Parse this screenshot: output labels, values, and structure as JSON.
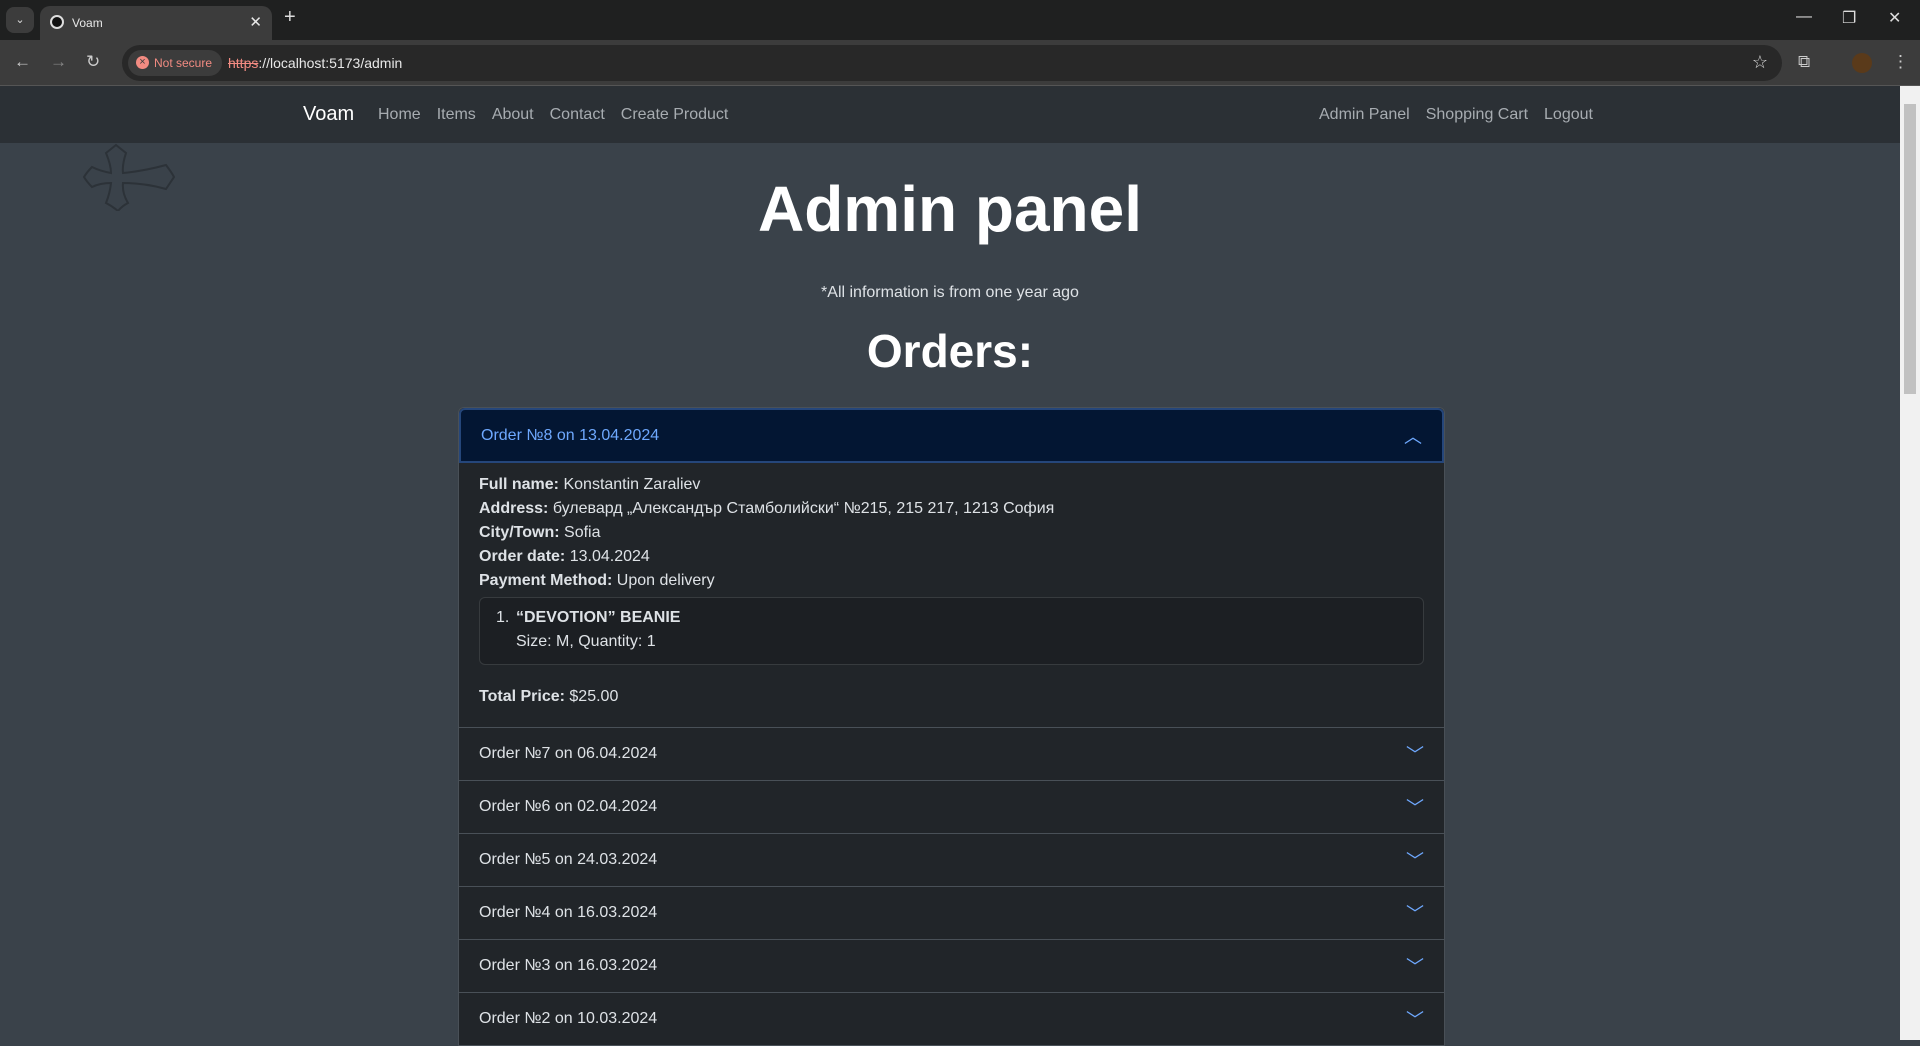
{
  "browser": {
    "tab_title": "Voam",
    "security": "Not secure",
    "url_scheme": "https",
    "url_rest": "://localhost:5173/admin"
  },
  "navbar": {
    "brand": "Voam",
    "left_links": [
      "Home",
      "Items",
      "About",
      "Contact",
      "Create Product"
    ],
    "right_links": [
      "Admin Panel",
      "Shopping Cart",
      "Logout"
    ]
  },
  "page": {
    "title": "Admin panel",
    "subtitle": "*All information is from one year ago",
    "orders_heading": "Orders:"
  },
  "expanded_order": {
    "header": "Order №8 on 13.04.2024",
    "fields": [
      {
        "label": "Full name:",
        "value": "Konstantin Zaraliev"
      },
      {
        "label": "Address:",
        "value": "булевард „Александър Стамболийски“ №215, 215 217, 1213 София"
      },
      {
        "label": "City/Town:",
        "value": "Sofia"
      },
      {
        "label": "Order date:",
        "value": "13.04.2024"
      },
      {
        "label": "Payment Method:",
        "value": "Upon delivery"
      }
    ],
    "items": [
      {
        "number": "1.",
        "name": "“DEVOTION” BEANIE",
        "details": "Size: M, Quantity: 1"
      }
    ],
    "total_label": "Total Price:",
    "total_value": "$25.00"
  },
  "collapsed_orders": [
    "Order №7 on 06.04.2024",
    "Order №6 on 02.04.2024",
    "Order №5 on 24.03.2024",
    "Order №4 on 16.03.2024",
    "Order №3 on 16.03.2024",
    "Order №2 on 10.03.2024"
  ],
  "colors": {
    "accent": "#6ea8fe",
    "header_active_bg": "#031633",
    "navbar_bg": "#2b3035",
    "page_bg": "#3a424a"
  }
}
